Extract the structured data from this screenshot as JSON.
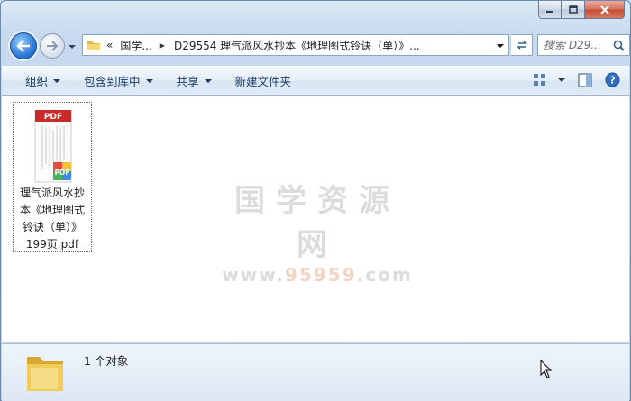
{
  "window": {
    "caption_buttons": [
      "minimize",
      "maximize",
      "close"
    ]
  },
  "address_bar": {
    "overflow": "«",
    "crumb_1": "国学...",
    "crumb_2": "D29554 理气派风水抄本《地理图式铃诀（单）》..."
  },
  "search": {
    "placeholder": "搜索 D29..."
  },
  "command_bar": {
    "organize": "组织",
    "include_in_library": "包含到库中",
    "share": "共享",
    "new_folder": "新建文件夹"
  },
  "file": {
    "thumb_label": "PDF",
    "badge_label": "PDF",
    "name_lines": [
      "理气派风水抄",
      "本《地理图式",
      "铃诀（单）》",
      "199页.pdf"
    ]
  },
  "watermark": {
    "line1": "国学资源网",
    "line2_prefix": "www.",
    "line2_highlight": "95959",
    "line2_suffix": ".com"
  },
  "details_pane": {
    "count": "1 个对象"
  },
  "colors": {
    "accent_blue": "#2d7ad8",
    "pdf_red": "#c92a2a",
    "folder_yellow": "#f2cc5a"
  }
}
